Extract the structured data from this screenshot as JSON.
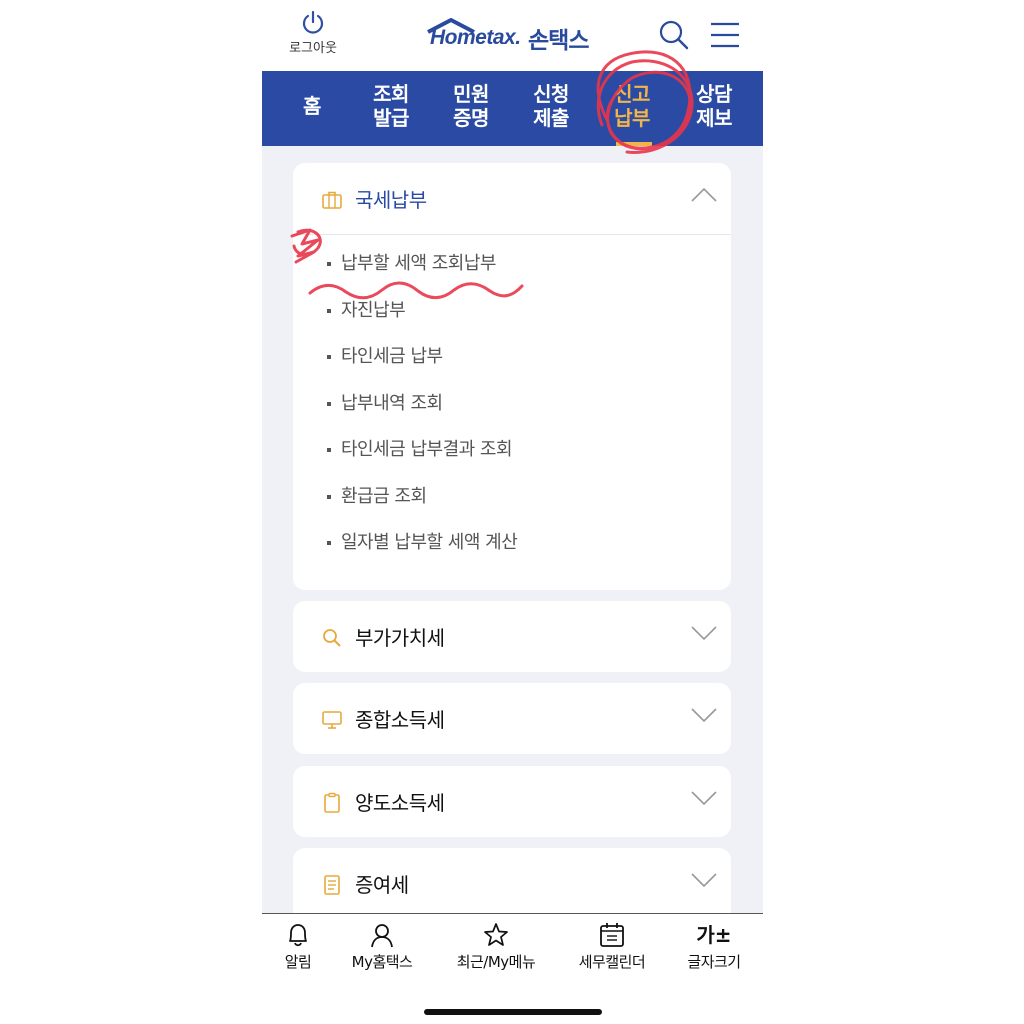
{
  "header": {
    "logout_label": "로그아웃",
    "logo_text": "Hometax.",
    "logo_kr": "손택스"
  },
  "nav": {
    "items": [
      {
        "line1": "홈",
        "line2": ""
      },
      {
        "line1": "조회",
        "line2": "발급"
      },
      {
        "line1": "민원",
        "line2": "증명"
      },
      {
        "line1": "신청",
        "line2": "제출"
      },
      {
        "line1": "신고",
        "line2": "납부"
      },
      {
        "line1": "상담",
        "line2": "제보"
      }
    ],
    "active_index": 4
  },
  "sections": [
    {
      "title": "국세납부",
      "icon": "briefcase-icon",
      "expanded": true,
      "items": [
        "납부할 세액 조회납부",
        "자진납부",
        "타인세금 납부",
        "납부내역 조회",
        "타인세금 납부결과 조회",
        "환급금 조회",
        "일자별 납부할 세액 계산"
      ]
    },
    {
      "title": "부가가치세",
      "icon": "search-icon",
      "expanded": false
    },
    {
      "title": "종합소득세",
      "icon": "monitor-icon",
      "expanded": false
    },
    {
      "title": "양도소득세",
      "icon": "clipboard-icon",
      "expanded": false
    },
    {
      "title": "증여세",
      "icon": "document-icon",
      "expanded": false
    }
  ],
  "bottom_bar": {
    "items": [
      {
        "label": "알림",
        "icon": "bell-icon"
      },
      {
        "label": "My홈택스",
        "icon": "person-icon"
      },
      {
        "label": "최근/My메뉴",
        "icon": "star-icon"
      },
      {
        "label": "세무캘린더",
        "icon": "calendar-icon"
      },
      {
        "label": "글자크기",
        "icon": "font-size-icon",
        "icon_text": "가±"
      }
    ]
  },
  "colors": {
    "nav_bg": "#2a4aa4",
    "active": "#f2b54a",
    "accent_icon": "#e8a93a",
    "annotation": "#e8364a"
  }
}
